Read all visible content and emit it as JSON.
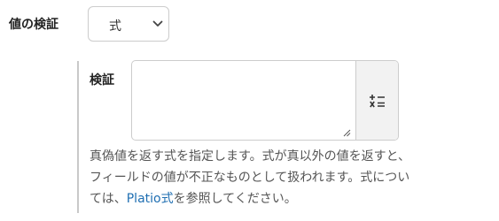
{
  "validation": {
    "label": "値の検証",
    "select": {
      "selected": "式",
      "icon": "chevron-down-icon"
    },
    "expression": {
      "label": "検証",
      "value": "",
      "formula_button_icon": "formula-icon"
    },
    "help": {
      "line1": "真偽値を返す式を指定します。式が真以外の値を返すと、",
      "line2": "フィールドの値が不正なものとして扱われます。式につい",
      "line3_prefix": "ては、",
      "link_text": "Platio式",
      "line3_suffix": "を参照してください。"
    }
  },
  "colors": {
    "link": "#1f6fb2",
    "border": "#cccccc",
    "button_bg": "#f2f2f2",
    "help_text": "#555555"
  }
}
